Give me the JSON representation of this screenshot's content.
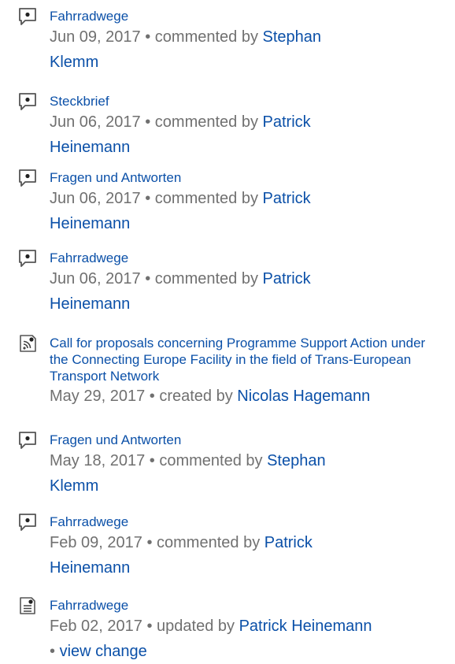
{
  "separator": "•",
  "items": [
    {
      "icon": "comment-icon",
      "title": "Fahrradwege",
      "date": "Jun 09, 2017",
      "action": "commented by",
      "user_first": "Stephan",
      "user_last": "Klemm"
    },
    {
      "icon": "comment-icon",
      "title": "Steckbrief",
      "date": "Jun 06, 2017",
      "action": "commented by",
      "user_first": "Patrick",
      "user_last": "Heinemann"
    },
    {
      "icon": "comment-icon",
      "title": "Fragen und Antworten",
      "date": "Jun 06, 2017",
      "action": "commented by",
      "user_first": "Patrick",
      "user_last": "Heinemann"
    },
    {
      "icon": "comment-icon",
      "title": "Fahrradwege",
      "date": "Jun 06, 2017",
      "action": "commented by",
      "user_first": "Patrick",
      "user_last": "Heinemann"
    },
    {
      "icon": "blog-post-icon",
      "title": "Call for proposals concerning Programme Support Action under the Connecting Europe Facility in the field of Trans-European Transport Network",
      "date": "May 29, 2017",
      "action": "created by",
      "user": "Nicolas Hagemann"
    },
    {
      "icon": "comment-icon",
      "title": "Fragen und Antworten",
      "date": "May 18, 2017",
      "action": "commented by",
      "user_first": "Stephan",
      "user_last": "Klemm"
    },
    {
      "icon": "comment-icon",
      "title": "Fahrradwege",
      "date": "Feb 09, 2017",
      "action": "commented by",
      "user_first": "Patrick",
      "user_last": "Heinemann"
    },
    {
      "icon": "page-icon",
      "title": "Fahrradwege",
      "date": "Feb 02, 2017",
      "action": "updated by",
      "user": "Patrick Heinemann",
      "extra_link": "view change"
    }
  ]
}
